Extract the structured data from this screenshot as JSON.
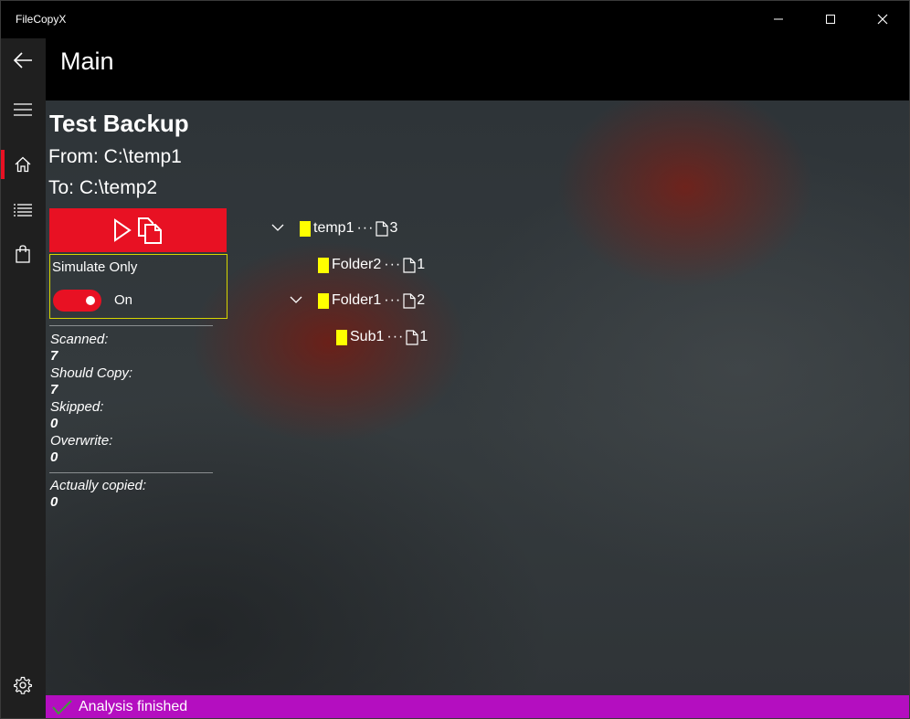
{
  "window": {
    "title": "FileCopyX",
    "minimize_icon": "minimize-icon",
    "maximize_icon": "maximize-icon",
    "close_icon": "close-icon"
  },
  "nav": {
    "items": [
      {
        "icon": "back-arrow-icon"
      },
      {
        "icon": "hamburger-menu-icon"
      },
      {
        "icon": "home-icon",
        "selected": true
      },
      {
        "icon": "list-icon"
      },
      {
        "icon": "shopping-bag-icon"
      },
      {
        "icon": "gear-icon"
      }
    ],
    "accent": "#e81123"
  },
  "header": {
    "title": "Main"
  },
  "task": {
    "name": "Test Backup",
    "from": "From: C:\\temp1",
    "to": "To: C:\\temp2",
    "run_button_icons": [
      "play-icon",
      "copy-icon"
    ],
    "run_button_color": "#e81123"
  },
  "simulate": {
    "label": "Simulate Only",
    "toggle_state": "On",
    "enabled": true
  },
  "stats": [
    {
      "label": "Scanned:",
      "value": "7"
    },
    {
      "label": "Should Copy:",
      "value": "7"
    },
    {
      "label": "Skipped:",
      "value": "0"
    },
    {
      "label": "Overwrite:",
      "value": "0"
    },
    {
      "label": "Actually copied:",
      "value": "0"
    }
  ],
  "tree": [
    {
      "name": "temp1",
      "dots": "···",
      "count": "3",
      "expanded": true,
      "level": 0
    },
    {
      "name": "Folder2",
      "dots": "···",
      "count": "1",
      "expanded": false,
      "level": 1
    },
    {
      "name": "Folder1",
      "dots": "···",
      "count": "2",
      "expanded": true,
      "level": 1
    },
    {
      "name": "Sub1",
      "dots": "···",
      "count": "1",
      "expanded": false,
      "level": 2
    }
  ],
  "folder_color": "#ffff00",
  "status": {
    "text": "Analysis finished",
    "icon": "checkmark-icon",
    "color": "#b40ec0"
  }
}
